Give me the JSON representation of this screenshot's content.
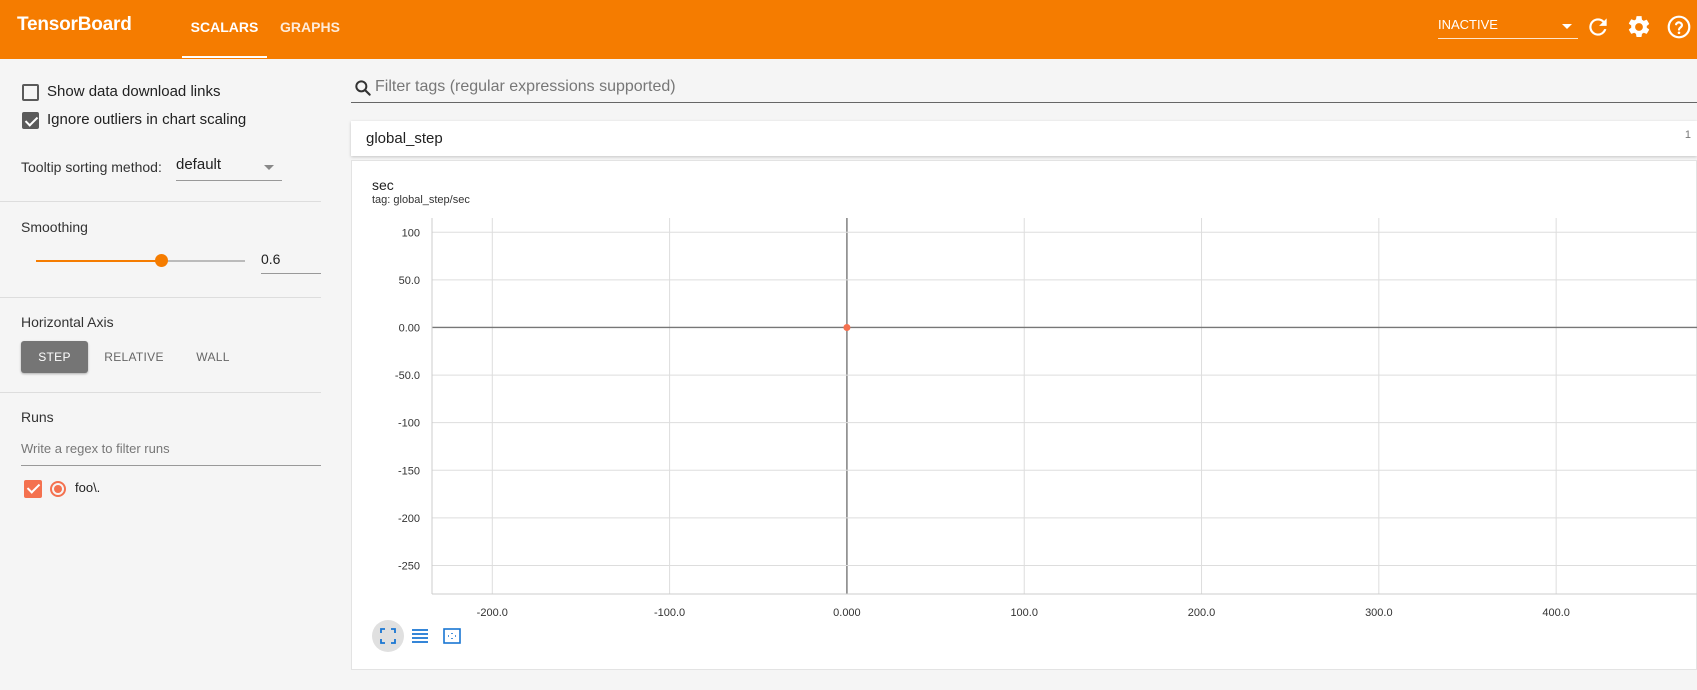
{
  "header": {
    "brand": "TensorBoard",
    "tabs": [
      {
        "label": "SCALARS",
        "active": true
      },
      {
        "label": "GRAPHS",
        "active": false
      }
    ],
    "run_status": "INACTIVE",
    "icons": [
      "refresh-icon",
      "settings-icon",
      "help-icon"
    ],
    "accent_color": "#f57c00"
  },
  "sidebar": {
    "show_download_links": {
      "label": "Show data download links",
      "checked": false
    },
    "ignore_outliers": {
      "label": "Ignore outliers in chart scaling",
      "checked": true
    },
    "tooltip_sorting": {
      "label": "Tooltip sorting method:",
      "value": "default"
    },
    "smoothing": {
      "label": "Smoothing",
      "value": "0.6",
      "fraction": 0.6
    },
    "horizontal_axis": {
      "label": "Horizontal Axis",
      "options": [
        "STEP",
        "RELATIVE",
        "WALL"
      ],
      "selected": "STEP"
    },
    "runs": {
      "label": "Runs",
      "filter_placeholder": "Write a regex to filter runs",
      "items": [
        {
          "name": "foo\\.",
          "checked": true,
          "color": "#f4714f"
        }
      ]
    }
  },
  "main": {
    "filter_placeholder": "Filter tags (regular expressions supported)",
    "category": {
      "title": "global_step",
      "count": "1"
    },
    "card": {
      "title": "sec",
      "tag": "tag: global_step/sec"
    },
    "toolbar": [
      "fit-domain-icon",
      "data-selection-icon",
      "zoom-out-icon"
    ]
  },
  "chart_data": {
    "type": "scatter",
    "title": "sec",
    "subtitle": "tag: global_step/sec",
    "xlabel": "",
    "ylabel": "",
    "x_ticks": [
      "-200.0",
      "-100.0",
      "0.000",
      "100.0",
      "200.0",
      "300.0",
      "400.0"
    ],
    "y_ticks": [
      "100",
      "50.0",
      "0.00",
      "-50.0",
      "-100",
      "-150",
      "-200",
      "-250"
    ],
    "xlim": [
      -234,
      480
    ],
    "ylim": [
      -280,
      115
    ],
    "series": [
      {
        "name": "foo\\.",
        "color": "#f4714f",
        "points": [
          {
            "x": 0,
            "y": 0
          }
        ]
      }
    ],
    "grid": true
  }
}
